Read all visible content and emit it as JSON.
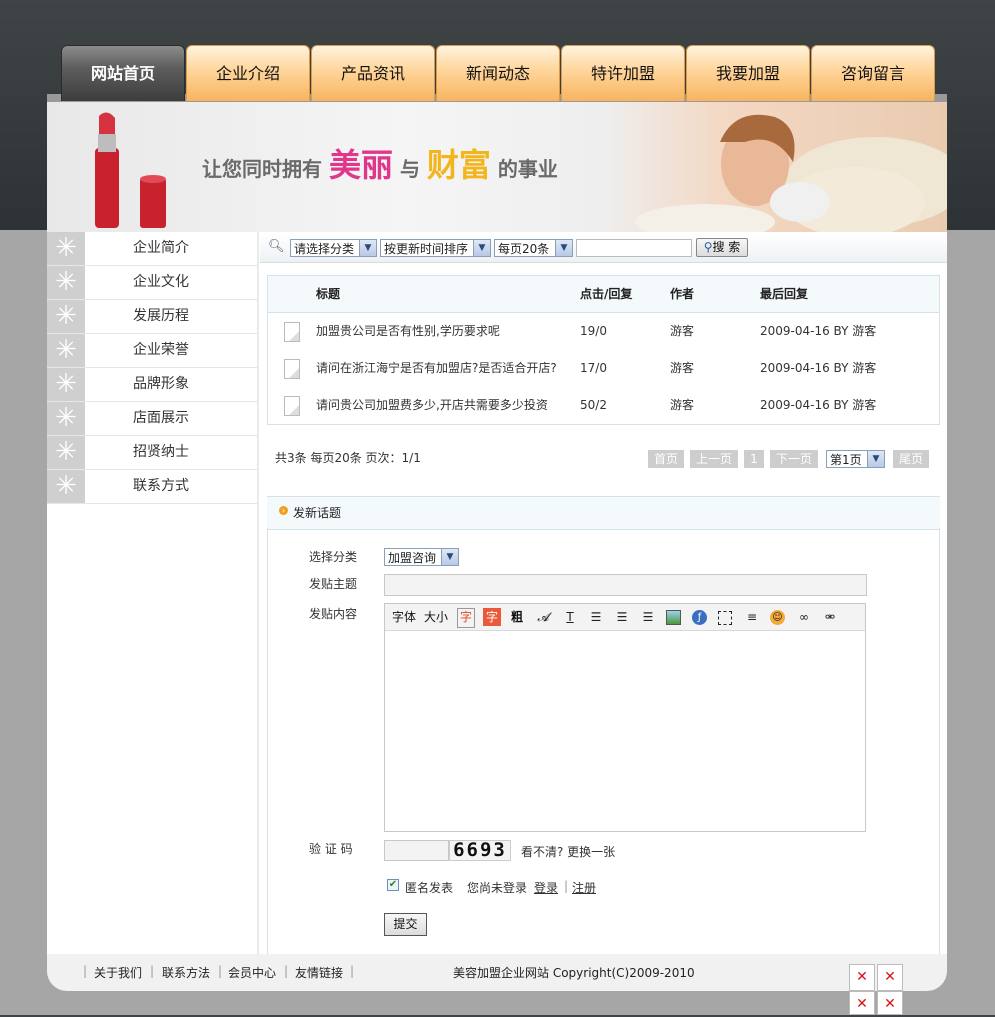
{
  "nav": {
    "tabs": [
      "网站首页",
      "企业介绍",
      "产品资讯",
      "新闻动态",
      "特许加盟",
      "我要加盟",
      "咨询留言"
    ],
    "active_index": 0
  },
  "banner": {
    "slogan_prefix": "让您同时拥有",
    "slogan_word1": "美丽",
    "slogan_mid": "与",
    "slogan_word2": "财富",
    "slogan_suffix": "的事业"
  },
  "sidebar": {
    "items": [
      "企业简介",
      "企业文化",
      "发展历程",
      "企业荣誉",
      "品牌形象",
      "店面展示",
      "招贤纳士",
      "联系方式"
    ]
  },
  "search": {
    "category": "请选择分类",
    "sort": "按更新时间排序",
    "per_page": "每页20条",
    "keyword": "",
    "button": "搜 索"
  },
  "topics": {
    "headers": {
      "title": "标题",
      "clicks": "点击/回复",
      "author": "作者",
      "last_reply": "最后回复"
    },
    "rows": [
      {
        "title": "加盟贵公司是否有性别,学历要求呢",
        "clicks": "19/0",
        "author": "游客",
        "last_reply": "2009-04-16 BY 游客"
      },
      {
        "title": "请问在浙江海宁是否有加盟店?是否适合开店?",
        "clicks": "17/0",
        "author": "游客",
        "last_reply": "2009-04-16 BY 游客"
      },
      {
        "title": "请问贵公司加盟费多少,开店共需要多少投资",
        "clicks": "50/2",
        "author": "游客",
        "last_reply": "2009-04-16 BY 游客"
      }
    ]
  },
  "pager": {
    "info": "共3条  每页20条  页次：1/1",
    "first": "首页",
    "prev": "上一页",
    "current": "1",
    "next": "下一页",
    "jump": "第1页",
    "last": "尾页"
  },
  "new_topic": {
    "title": "发新话题",
    "category_label": "选择分类",
    "category_value": "加盟咨询",
    "subject_label": "发贴主题",
    "subject_value": "",
    "content_label": "发贴内容",
    "toolbar": {
      "font": "字体",
      "size": "大小",
      "color_a": "字",
      "color_b": "字",
      "bold": "粗"
    },
    "captcha_label": "验 证 码",
    "captcha_value": "",
    "captcha_image_text": "6693",
    "captcha_refresh": "看不清? 更换一张",
    "anonymous_label": "匿名发表",
    "anonymous_checked": true,
    "not_logged_in": "您尚未登录",
    "login": "登录",
    "register": "注册",
    "submit": "提交"
  },
  "footer": {
    "links": [
      "关于我们",
      "联系方法",
      "会员中心",
      "友情链接"
    ],
    "copyright": "美容加盟企业网站  Copyright(C)2009-2010"
  },
  "colors": {
    "accent_orange": "#f7b460",
    "pink": "#e0368c",
    "gold": "#f2b51c"
  }
}
